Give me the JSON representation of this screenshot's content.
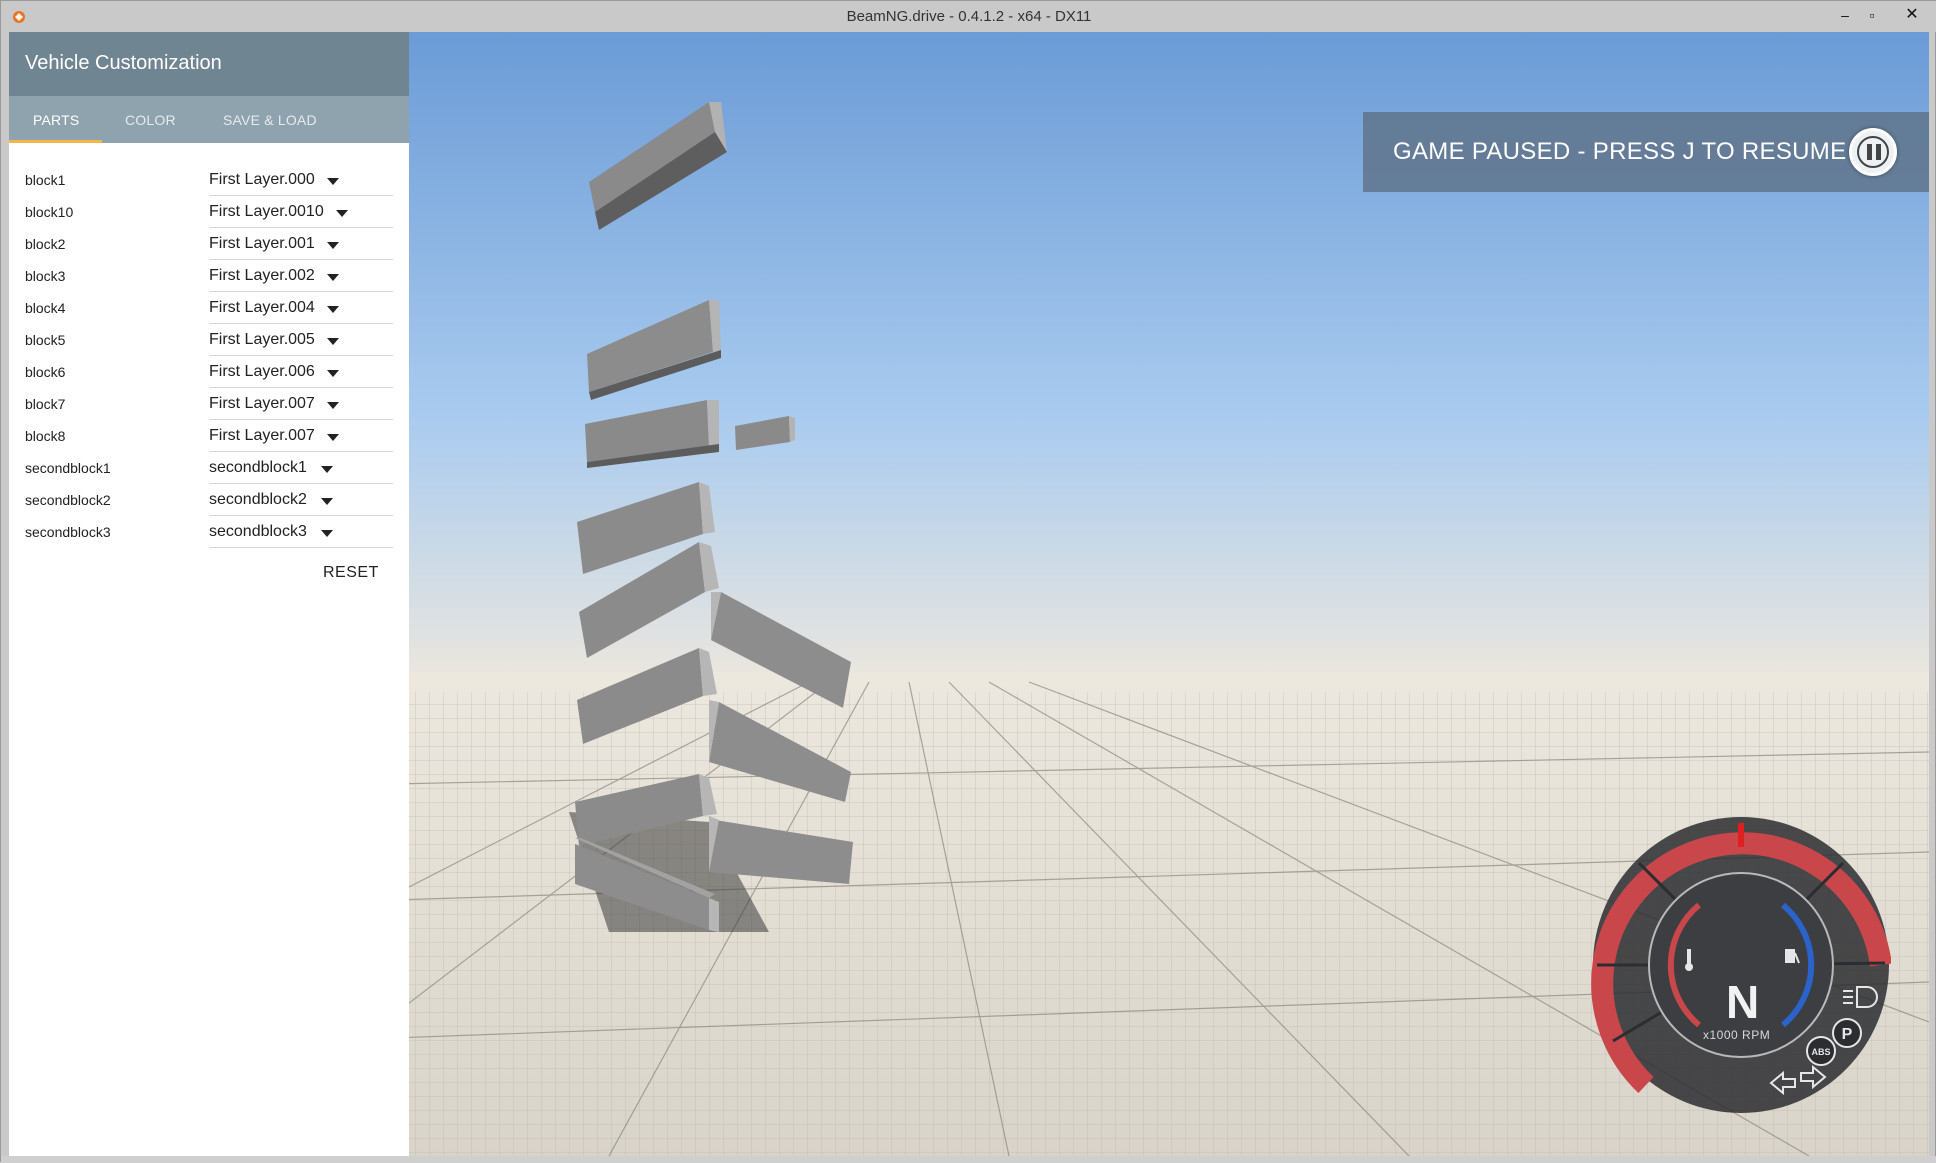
{
  "window": {
    "title": "BeamNG.drive - 0.4.1.2 - x64 - DX11",
    "minimize_glyph": "–",
    "maximize_glyph": "▫",
    "close_glyph": "✕"
  },
  "panel": {
    "title": "Vehicle Customization",
    "tabs": [
      {
        "label": "PARTS",
        "active": true
      },
      {
        "label": "COLOR",
        "active": false
      },
      {
        "label": "SAVE & LOAD",
        "active": false
      }
    ],
    "parts": [
      {
        "label": "block1",
        "value": "First Layer.000"
      },
      {
        "label": "block10",
        "value": "First Layer.0010"
      },
      {
        "label": "block2",
        "value": "First Layer.001"
      },
      {
        "label": "block3",
        "value": "First Layer.002"
      },
      {
        "label": "block4",
        "value": "First Layer.004"
      },
      {
        "label": "block5",
        "value": "First Layer.005"
      },
      {
        "label": "block6",
        "value": "First Layer.006"
      },
      {
        "label": "block7",
        "value": "First Layer.007"
      },
      {
        "label": "block8",
        "value": "First Layer.007"
      },
      {
        "label": "secondblock1",
        "value": "secondblock1"
      },
      {
        "label": "secondblock2",
        "value": "secondblock2"
      },
      {
        "label": "secondblock3",
        "value": "secondblock3"
      }
    ],
    "reset_label": "RESET"
  },
  "pause": {
    "text": "GAME PAUSED - PRESS J TO RESUME"
  },
  "gauge": {
    "gear": "N",
    "unit_label": "x1000 RPM",
    "abs_label": "ABS",
    "park_label": "P"
  },
  "colors": {
    "panel_header": "#6f8592",
    "tabbar": "#8fa3ae",
    "tab_accent": "#f4b54a",
    "gauge_red": "#c9474b",
    "gauge_blue": "#2a63c9"
  }
}
